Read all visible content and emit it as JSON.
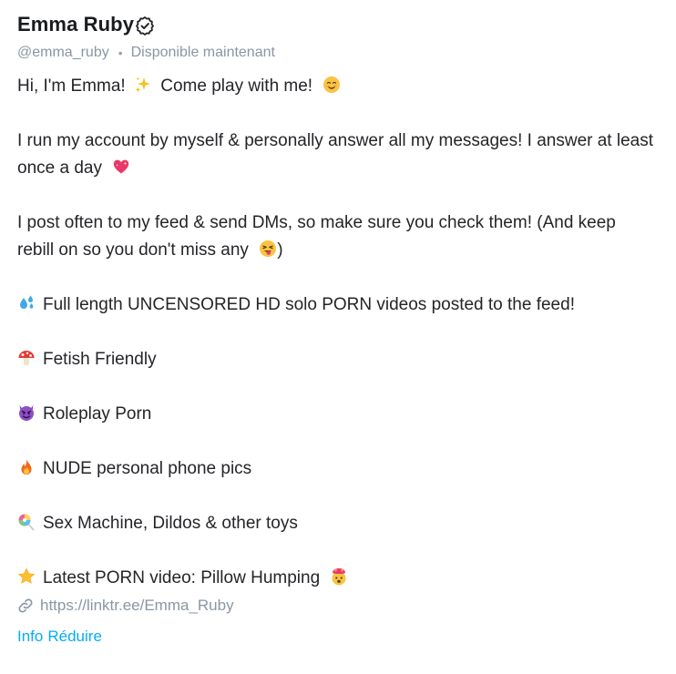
{
  "profile": {
    "display_name": "Emma Ruby",
    "handle": "@emma_ruby",
    "separator": "•",
    "status": "Disponible maintenant",
    "verified_icon": "verified-badge-icon"
  },
  "bio": {
    "intro": "Hi, I'm Emma!",
    "intro_tail": "Come play with me!",
    "paragraph1": "I run my account by myself & personally answer all my messages! I answer at least once a day",
    "paragraph2_a": "I post often to my feed & send DMs, so make sure you check them! (And keep rebill on so you don't miss any",
    "paragraph2_b": ")",
    "items": [
      {
        "icon": "sweat-droplets-emoji-icon",
        "text": "Full length UNCENSORED HD solo PORN videos posted to the feed!"
      },
      {
        "icon": "mushroom-emoji-icon",
        "text": "Fetish Friendly"
      },
      {
        "icon": "smiling-devil-emoji-icon",
        "text": "Roleplay Porn"
      },
      {
        "icon": "fire-emoji-icon",
        "text": "NUDE personal phone pics"
      },
      {
        "icon": "lollipop-emoji-icon",
        "text": "Sex Machine, Dildos & other toys"
      },
      {
        "icon": "star-emoji-icon",
        "text": "Latest PORN video: Pillow Humping",
        "trail_icon": "exploding-head-emoji-icon"
      }
    ]
  },
  "link": {
    "url": "https://linktr.ee/Emma_Ruby",
    "icon": "link-chain-icon"
  },
  "actions": {
    "info_label": "Info",
    "collapse_label": "Réduire"
  },
  "colors": {
    "text": "#242529",
    "muted": "#8a96a3",
    "accent": "#00aff0"
  }
}
